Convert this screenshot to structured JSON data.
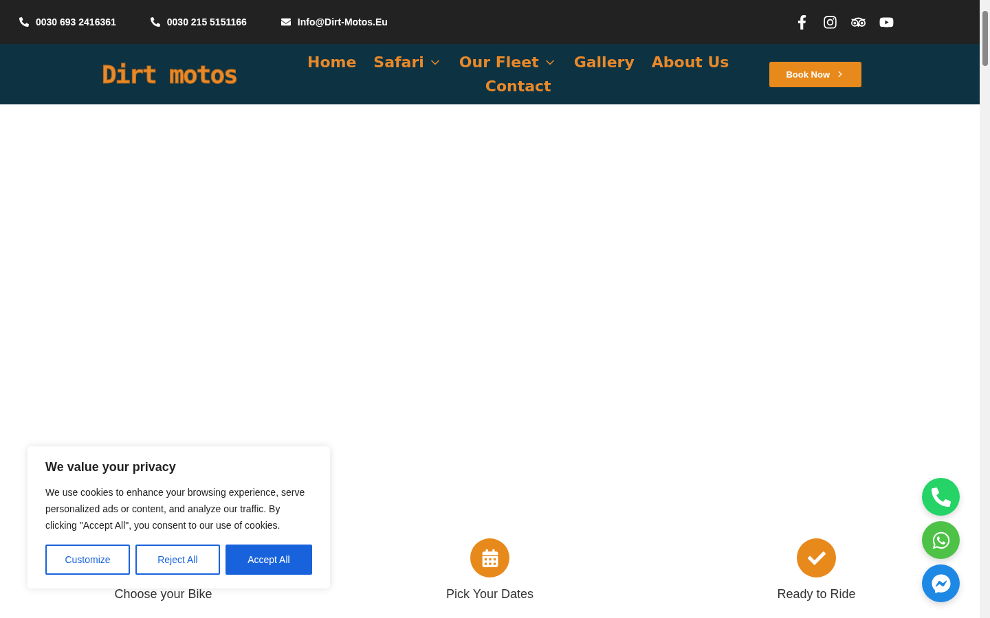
{
  "top_bar": {
    "contacts": [
      {
        "kind": "phone",
        "text": "0030 693 2416361"
      },
      {
        "kind": "phone",
        "text": "0030 215 5151166"
      },
      {
        "kind": "email",
        "text": "Info@Dirt-Motos.Eu"
      }
    ],
    "social": [
      {
        "kind": "facebook"
      },
      {
        "kind": "instagram"
      },
      {
        "kind": "tripadvisor"
      },
      {
        "kind": "youtube"
      }
    ]
  },
  "header": {
    "logo": "Dirt motos",
    "nav": [
      {
        "label": "Home",
        "dropdown": false
      },
      {
        "label": "Safari",
        "dropdown": true
      },
      {
        "label": "Our Fleet",
        "dropdown": true
      },
      {
        "label": "Gallery",
        "dropdown": false
      },
      {
        "label": "About Us",
        "dropdown": false
      },
      {
        "label": "Contact",
        "dropdown": false
      }
    ],
    "cta": "Book Now"
  },
  "steps": [
    {
      "kind": "bike",
      "label": "Choose your Bike",
      "icon_visible": false
    },
    {
      "kind": "calendar",
      "label": "Pick Your Dates",
      "icon_visible": true
    },
    {
      "kind": "check",
      "label": "Ready to Ride",
      "icon_visible": true
    }
  ],
  "floating_buttons": [
    {
      "kind": "phone",
      "color": "#25d366"
    },
    {
      "kind": "whatsapp",
      "color": "#4dc247"
    },
    {
      "kind": "messenger",
      "color": "#1e88e5"
    }
  ],
  "cookie_banner": {
    "title": "We value your privacy",
    "text": "We use cookies to enhance your browsing experience, serve personalized ads or content, and analyze our traffic. By clicking \"Accept All\", you consent to our use of cookies.",
    "buttons": [
      {
        "label": "Customize",
        "primary": false
      },
      {
        "label": "Reject All",
        "primary": false
      },
      {
        "label": "Accept All",
        "primary": true
      }
    ]
  }
}
